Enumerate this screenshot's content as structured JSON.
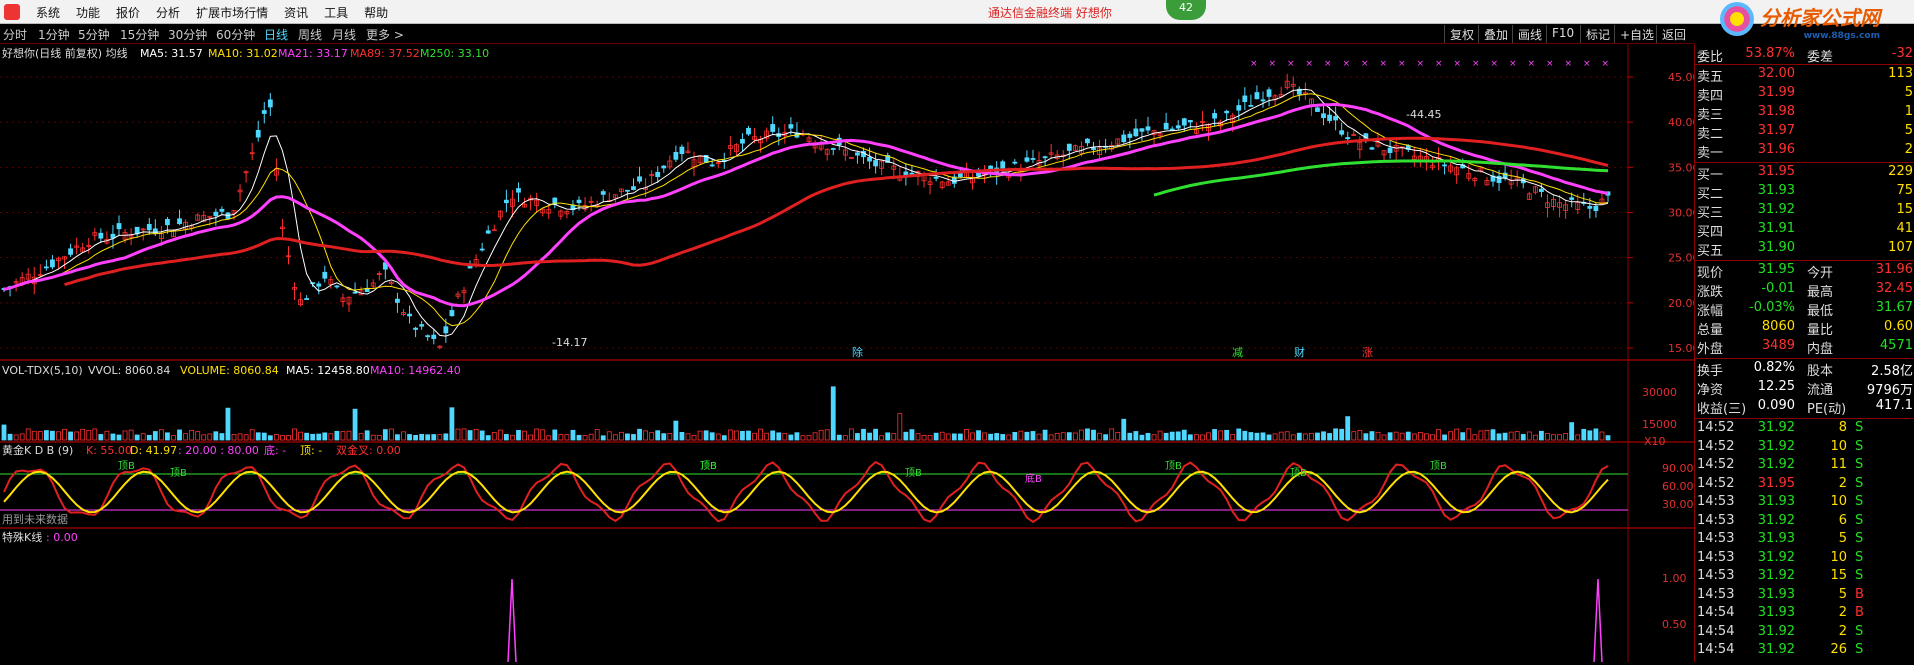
{
  "menubar": {
    "items": [
      "系统",
      "功能",
      "报价",
      "分析",
      "扩展市场行情",
      "资讯",
      "工具",
      "帮助"
    ],
    "notice": "通达信金融终端   好想你",
    "badge": "42",
    "brand": "分析家公式网",
    "brand_url": "www.88gs.com"
  },
  "timeframes": [
    "分时",
    "1分钟",
    "5分钟",
    "15分钟",
    "30分钟",
    "60分钟",
    "日线",
    "周线",
    "月线",
    "更多 >"
  ],
  "active_timeframe": "日线",
  "right_buttons": [
    "复权",
    "叠加",
    "画线",
    "F10",
    "标记",
    "+自选",
    "返回"
  ],
  "main_header": {
    "title": "好想你(日线 前复权) 均线",
    "ma5": "MA5: 31.57",
    "ma10": "MA10: 31.02",
    "ma21": "MA21: 33.17",
    "ma89": "MA89: 37.52",
    "ma250": "M250: 33.10"
  },
  "price_axis": [
    "45.00",
    "40.00",
    "35.00",
    "30.00",
    "25.00",
    "20.00",
    "15.00"
  ],
  "price_labels": {
    "high": "44.45",
    "low": "14.17"
  },
  "event_markers": [
    "除",
    "减",
    "财",
    "涨"
  ],
  "volume_header": {
    "title": "VOL-TDX(5,10)",
    "vvol": "VVOL: 8060.84",
    "volume": "VOLUME: 8060.84",
    "ma5": "MA5: 12458.80",
    "ma10": "MA10: 14962.40"
  },
  "volume_axis": [
    "30000",
    "15000",
    "X10"
  ],
  "kdj_header": {
    "title": "黄金K D B (9)",
    "k": "K: 55.00",
    "d": "D: 41.97",
    "levels": ": 20.00 : 80.00",
    "bottom": "底: -",
    "top": "顶: -",
    "cross": "双金叉: 0.00"
  },
  "kdj_axis": [
    "90.00",
    "60.00",
    "30.00"
  ],
  "kdj_labels": [
    "顶B",
    "顶B",
    "顶B",
    "顶B",
    "顶B",
    "顶B",
    "顶B",
    "底B",
    "顶B"
  ],
  "kdj_note": "用到未来数据",
  "special_header": {
    "title": "特殊K线",
    "value": ": 0.00"
  },
  "special_axis": [
    "1.00",
    "0.50"
  ],
  "quote": {
    "weibi": {
      "label": "委比",
      "value": "53.87%",
      "label2": "委差",
      "value2": "-32"
    },
    "asks": [
      {
        "l": "卖五",
        "p": "32.00",
        "v": "113"
      },
      {
        "l": "卖四",
        "p": "31.99",
        "v": "5"
      },
      {
        "l": "卖三",
        "p": "31.98",
        "v": "1"
      },
      {
        "l": "卖二",
        "p": "31.97",
        "v": "5"
      },
      {
        "l": "卖一",
        "p": "31.96",
        "v": "2"
      }
    ],
    "bids": [
      {
        "l": "买一",
        "p": "31.95",
        "v": "229"
      },
      {
        "l": "买二",
        "p": "31.93",
        "v": "75"
      },
      {
        "l": "买三",
        "p": "31.92",
        "v": "15"
      },
      {
        "l": "买四",
        "p": "31.91",
        "v": "41"
      },
      {
        "l": "买五",
        "p": "31.90",
        "v": "107"
      }
    ],
    "stats": [
      {
        "l1": "现价",
        "v1": "31.95",
        "l2": "今开",
        "v2": "31.96"
      },
      {
        "l1": "涨跌",
        "v1": "-0.01",
        "l2": "最高",
        "v2": "32.45"
      },
      {
        "l1": "涨幅",
        "v1": "-0.03%",
        "l2": "最低",
        "v2": "31.67"
      },
      {
        "l1": "总量",
        "v1": "8060",
        "l2": "量比",
        "v2": "0.60"
      },
      {
        "l1": "外盘",
        "v1": "3489",
        "l2": "内盘",
        "v2": "4571"
      }
    ],
    "fund": [
      {
        "l1": "换手",
        "v1": "0.82%",
        "l2": "股本",
        "v2": "2.58亿"
      },
      {
        "l1": "净资",
        "v1": "12.25",
        "l2": "流通",
        "v2": "9796万"
      },
      {
        "l1": "收益(三)",
        "v1": "0.090",
        "l2": "PE(动)",
        "v2": "417.1"
      }
    ],
    "ticks": [
      {
        "t": "14:52",
        "p": "31.92",
        "v": "8",
        "s": "S"
      },
      {
        "t": "14:52",
        "p": "31.92",
        "v": "10",
        "s": "S"
      },
      {
        "t": "14:52",
        "p": "31.92",
        "v": "11",
        "s": "S"
      },
      {
        "t": "14:52",
        "p": "31.95",
        "v": "2",
        "s": "S"
      },
      {
        "t": "14:53",
        "p": "31.93",
        "v": "10",
        "s": "S"
      },
      {
        "t": "14:53",
        "p": "31.92",
        "v": "6",
        "s": "S"
      },
      {
        "t": "14:53",
        "p": "31.93",
        "v": "5",
        "s": "S"
      },
      {
        "t": "14:53",
        "p": "31.92",
        "v": "10",
        "s": "S"
      },
      {
        "t": "14:53",
        "p": "31.92",
        "v": "15",
        "s": "S"
      },
      {
        "t": "14:53",
        "p": "31.93",
        "v": "5",
        "s": "B"
      },
      {
        "t": "14:54",
        "p": "31.93",
        "v": "2",
        "s": "B"
      },
      {
        "t": "14:54",
        "p": "31.92",
        "v": "2",
        "s": "S"
      },
      {
        "t": "14:54",
        "p": "31.92",
        "v": "26",
        "s": "S"
      }
    ]
  },
  "colors": {
    "up": "#ff3030",
    "down": "#4fd8ff",
    "ma5": "#ffffff",
    "ma10": "#ffe000",
    "ma21": "#ff40ff",
    "ma89": "#e02020",
    "ma250": "#30e030",
    "grid": "#8b0000"
  }
}
